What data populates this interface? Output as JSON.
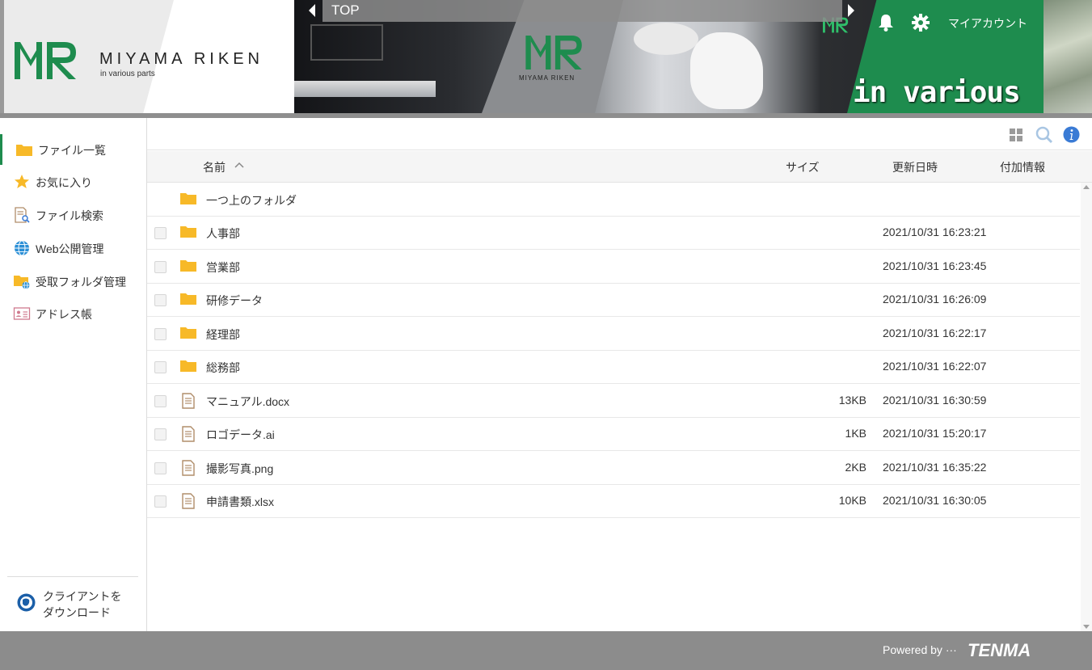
{
  "header": {
    "brand_name": "MIYAMA RIKEN",
    "brand_tagline": "in various parts",
    "photo_logo_text": "MIYAMA RIKEN",
    "banner_tagline": "in various parts",
    "breadcrumb": "TOP",
    "account_label": "マイアカウント",
    "brand_color": "#1e8c4e"
  },
  "sidebar": {
    "items": [
      {
        "label": "ファイル一覧",
        "icon": "folder-icon",
        "active": true
      },
      {
        "label": "お気に入り",
        "icon": "star-icon"
      },
      {
        "label": "ファイル検索",
        "icon": "file-search-icon"
      },
      {
        "label": "Web公開管理",
        "icon": "globe-icon"
      },
      {
        "label": "受取フォルダ管理",
        "icon": "receive-folder-icon"
      },
      {
        "label": "アドレス帳",
        "icon": "address-book-icon"
      }
    ],
    "download_label_line1": "クライアントを",
    "download_label_line2": "ダウンロード"
  },
  "table": {
    "headers": {
      "name": "名前",
      "size": "サイズ",
      "date": "更新日時",
      "info": "付加情報"
    },
    "parent_folder": "一つ上のフォルダ",
    "rows": [
      {
        "type": "folder",
        "name": "人事部",
        "size": "",
        "date": "2021/10/31 16:23:21"
      },
      {
        "type": "folder",
        "name": "営業部",
        "size": "",
        "date": "2021/10/31 16:23:45"
      },
      {
        "type": "folder",
        "name": "研修データ",
        "size": "",
        "date": "2021/10/31 16:26:09"
      },
      {
        "type": "folder",
        "name": "経理部",
        "size": "",
        "date": "2021/10/31 16:22:17"
      },
      {
        "type": "folder",
        "name": "総務部",
        "size": "",
        "date": "2021/10/31 16:22:07"
      },
      {
        "type": "file",
        "name": "マニュアル.docx",
        "size": "13KB",
        "date": "2021/10/31 16:30:59"
      },
      {
        "type": "file",
        "name": "ロゴデータ.ai",
        "size": "1KB",
        "date": "2021/10/31 15:20:17"
      },
      {
        "type": "file",
        "name": "撮影写真.png",
        "size": "2KB",
        "date": "2021/10/31 16:35:22"
      },
      {
        "type": "file",
        "name": "申請書類.xlsx",
        "size": "10KB",
        "date": "2021/10/31 16:30:05"
      }
    ]
  },
  "footer": {
    "powered_by": "Powered by ···",
    "vendor": "TENMA"
  }
}
